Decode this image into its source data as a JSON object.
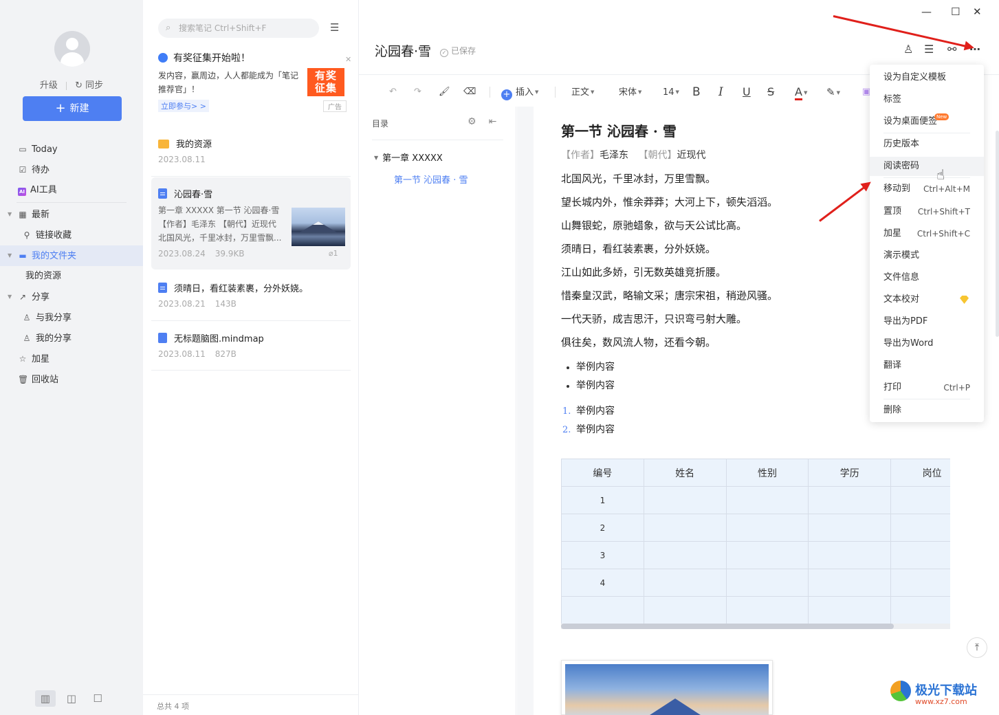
{
  "sidebar": {
    "user_actions": {
      "upgrade": "升级",
      "sync": "同步"
    },
    "new_button": "新建",
    "nav": {
      "today": "Today",
      "todo": "待办",
      "ai_tools": "AI工具",
      "recent": "最新",
      "link_favorites": "链接收藏",
      "my_folders": "我的文件夹",
      "my_resources": "我的资源",
      "share": "分享",
      "shared_with_me": "与我分享",
      "my_shares": "我的分享",
      "starred": "加星",
      "recycle_bin": "回收站"
    }
  },
  "notelist": {
    "search_placeholder": "搜索笔记 Ctrl+Shift+F",
    "ad": {
      "title": "有奖征集开始啦！",
      "text": "发内容，赢周边，人人都能成为「笔记推荐官」！",
      "link": "立即参与> >",
      "image_text_1": "有奖",
      "image_text_2": "征集",
      "tag": "广告"
    },
    "items": [
      {
        "title": "我的资源",
        "date": "2023.08.11"
      },
      {
        "title": "沁园春·雪",
        "excerpt": "第一章 XXXXX 第一节 沁园春·雪 【作者】毛泽东 【朝代】近现代 北国风光，千里冰封，万里雪飘...",
        "date": "2023.08.24",
        "size": "39.9KB",
        "attachments": "1"
      },
      {
        "title": "须晴日，看红装素裹，分外妖娆。",
        "date": "2023.08.21",
        "size": "143B"
      },
      {
        "title": "无标题脑图.mindmap",
        "date": "2023.08.11",
        "size": "827B"
      }
    ],
    "footer": "总共 4 项"
  },
  "editor": {
    "title": "沁园春·雪",
    "saved": "已保存",
    "toolbar": {
      "insert": "插入",
      "paragraph": "正文",
      "font": "宋体",
      "size": "14",
      "bold": "B",
      "italic": "I",
      "underline": "U",
      "strike": "S",
      "font_color": "A"
    },
    "toc": {
      "title": "目录",
      "h1": "第一章 XXXXX",
      "h2": "第一节 沁园春 · 雪"
    },
    "content": {
      "heading": "第一节 沁园春 · 雪",
      "meta": {
        "author_label": "作者",
        "author": "毛泽东",
        "dynasty_label": "朝代",
        "dynasty": "近现代"
      },
      "lines": [
        "北国风光，千里冰封，万里雪飘。",
        "望长城内外，惟余莽莽；大河上下，顿失滔滔。",
        "山舞银蛇，原驰蜡象，欲与天公试比高。",
        "须晴日，看红装素裹，分外妖娆。",
        "江山如此多娇，引无数英雄竞折腰。",
        "惜秦皇汉武，略输文采；唐宗宋祖，稍逊风骚。",
        "一代天骄，成吉思汗，只识弯弓射大雕。",
        "俱往矣，数风流人物，还看今朝。"
      ],
      "bullets": [
        "举例内容",
        "举例内容"
      ],
      "numbered": [
        {
          "n": "1.",
          "text": "举例内容"
        },
        {
          "n": "2.",
          "text": "举例内容"
        }
      ],
      "table": {
        "headers": [
          "编号",
          "姓名",
          "性别",
          "学历",
          "岗位"
        ],
        "rows": [
          [
            "1",
            "",
            "",
            "",
            ""
          ],
          [
            "2",
            "",
            "",
            "",
            ""
          ],
          [
            "3",
            "",
            "",
            "",
            ""
          ],
          [
            "4",
            "",
            "",
            "",
            ""
          ],
          [
            "",
            "",
            "",
            "",
            ""
          ]
        ]
      }
    }
  },
  "menu": {
    "items": [
      {
        "label": "设为自定义模板"
      },
      {
        "label": "标签"
      },
      {
        "label": "设为桌面便签",
        "badge": "New"
      },
      {
        "label": "历史版本"
      },
      {
        "label": "阅读密码"
      },
      {
        "label": "移动到",
        "shortcut": "Ctrl+Alt+M"
      },
      {
        "label": "置顶",
        "shortcut": "Ctrl+Shift+T"
      },
      {
        "label": "加星",
        "shortcut": "Ctrl+Shift+C"
      },
      {
        "label": "演示模式"
      },
      {
        "label": "文件信息"
      },
      {
        "label": "文本校对"
      },
      {
        "label": "导出为PDF"
      },
      {
        "label": "导出为Word"
      },
      {
        "label": "翻译"
      },
      {
        "label": "打印",
        "shortcut": "Ctrl+P"
      },
      {
        "label": "删除"
      }
    ]
  },
  "watermark": {
    "name": "极光下载站",
    "url": "www.xz7.com"
  },
  "colors": {
    "accent": "#4e7ff2",
    "arrow": "#e0201b",
    "sidebar_bg": "#f2f3f5"
  }
}
